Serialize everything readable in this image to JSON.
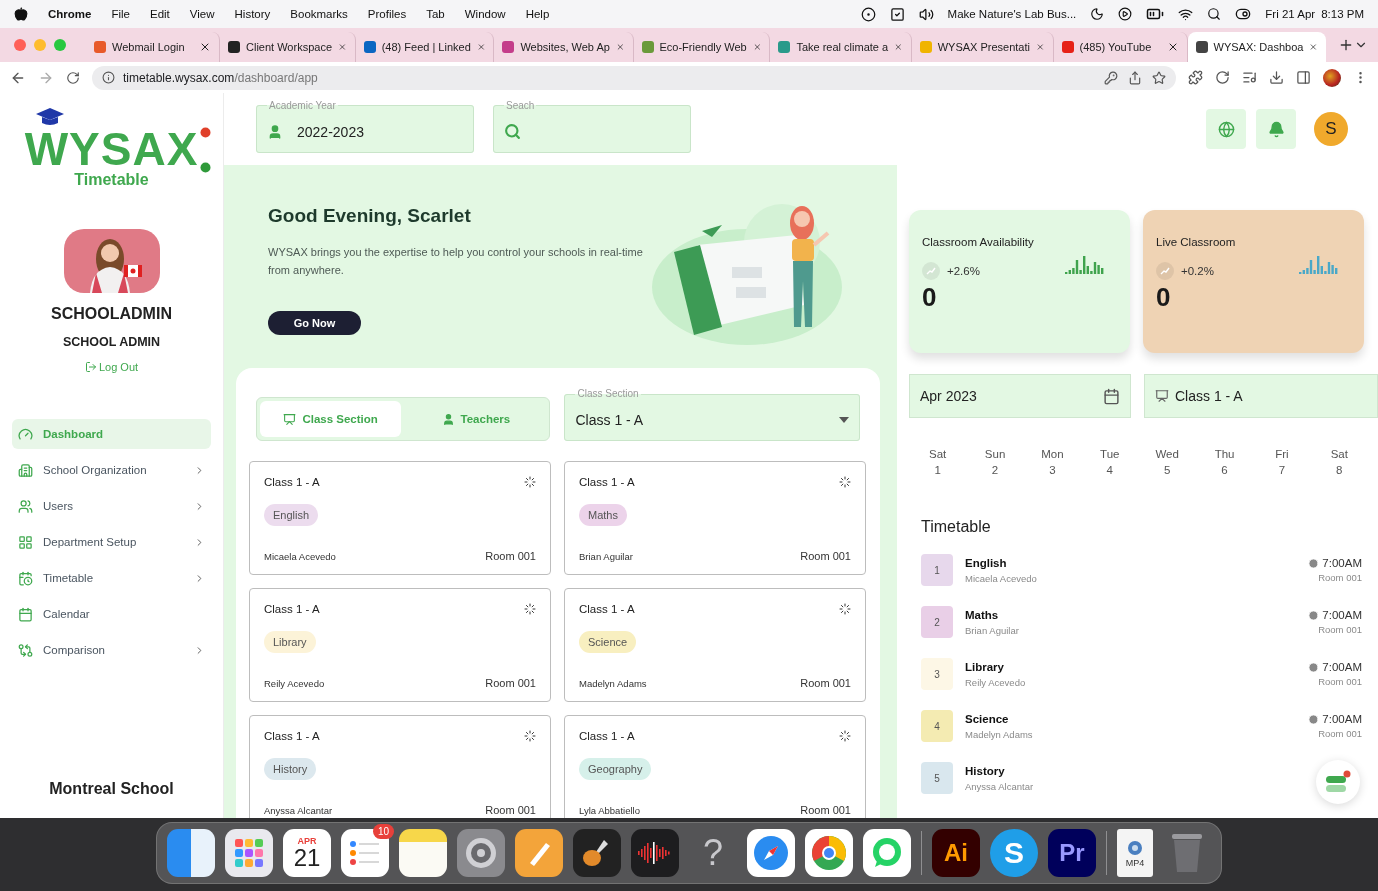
{
  "menubar": {
    "app": "Chrome",
    "menus": [
      "File",
      "Edit",
      "View",
      "History",
      "Bookmarks",
      "Profiles",
      "Tab",
      "Window",
      "Help"
    ],
    "now_playing": "Make Nature's Lab Bus...",
    "date": "Fri 21 Apr",
    "time": "8:13 PM"
  },
  "browser": {
    "tabs": [
      {
        "title": "Webmail Login",
        "selected": false
      },
      {
        "title": "Client Workspace",
        "selected": false
      },
      {
        "title": "(48) Feed | Linked",
        "selected": false
      },
      {
        "title": "Websites, Web Ap",
        "selected": false
      },
      {
        "title": "Eco-Friendly Web",
        "selected": false
      },
      {
        "title": "Take real climate a",
        "selected": false
      },
      {
        "title": "WYSAX Presentati",
        "selected": false
      },
      {
        "title": "(485) YouTube",
        "selected": false
      },
      {
        "title": "WYSAX: Dashboa",
        "selected": true
      }
    ],
    "url_host": "timetable.wysax.com",
    "url_path": "/dashboard/app"
  },
  "sidebar": {
    "logo": "WYSAX",
    "logo_sub": "Timetable",
    "name": "SCHOOLADMIN",
    "role": "SCHOOL ADMIN",
    "logout": "Log Out",
    "nav": [
      {
        "label": "Dashboard",
        "selected": true,
        "expandable": false
      },
      {
        "label": "School Organization",
        "selected": false,
        "expandable": true
      },
      {
        "label": "Users",
        "selected": false,
        "expandable": true
      },
      {
        "label": "Department Setup",
        "selected": false,
        "expandable": true
      },
      {
        "label": "Timetable",
        "selected": false,
        "expandable": true
      },
      {
        "label": "Calendar",
        "selected": false,
        "expandable": false
      },
      {
        "label": "Comparison",
        "selected": false,
        "expandable": true
      }
    ],
    "school": "Montreal School"
  },
  "topbar": {
    "year_field": {
      "label": "Academic Year",
      "value": "2022-2023"
    },
    "search_field": {
      "label": "Seach"
    },
    "avatar": "S"
  },
  "hero": {
    "title": "Good Evening, Scarlet",
    "text": "WYSAX brings you the expertise to help you control your schools in real-time from anywhere.",
    "button": "Go Now"
  },
  "class_panel": {
    "view_tabs": [
      {
        "label": "Class Section",
        "selected": true
      },
      {
        "label": "Teachers",
        "selected": false
      }
    ],
    "section_select": {
      "label": "Class Section",
      "value": "Class 1 - A"
    },
    "cards": [
      {
        "class": "Class 1 - A",
        "subject": "English",
        "color": "#ecdcee",
        "teacher": "Micaela Acevedo",
        "room": "Room 001"
      },
      {
        "class": "Class 1 - A",
        "subject": "Maths",
        "color": "#ecd3ea",
        "teacher": "Brian Aguilar",
        "room": "Room 001"
      },
      {
        "class": "Class 1 - A",
        "subject": "Library",
        "color": "#fcf3d8",
        "teacher": "Reily Acevedo",
        "room": "Room 001"
      },
      {
        "class": "Class 1 - A",
        "subject": "Science",
        "color": "#f8efc0",
        "teacher": "Madelyn Adams",
        "room": "Room 001"
      },
      {
        "class": "Class 1 - A",
        "subject": "History",
        "color": "#dce8ee",
        "teacher": "Anyssa Alcantar",
        "room": "Room 001"
      },
      {
        "class": "Class 1 - A",
        "subject": "Geography",
        "color": "#d6f0ea",
        "teacher": "Lyla Abbatiello",
        "room": "Room 001"
      }
    ]
  },
  "stats": [
    {
      "title": "Classroom Availability",
      "change": "+2.6%",
      "value": "0",
      "color": "#e3f8e3"
    },
    {
      "title": "Live Classroom",
      "change": "+0.2%",
      "value": "0",
      "color": "#efd3b4"
    }
  ],
  "schedule": {
    "month_field": "Apr 2023",
    "class_field": "Class 1 - A",
    "days": [
      {
        "day": "Sat",
        "date": "1"
      },
      {
        "day": "Sun",
        "date": "2"
      },
      {
        "day": "Mon",
        "date": "3"
      },
      {
        "day": "Tue",
        "date": "4"
      },
      {
        "day": "Wed",
        "date": "5"
      },
      {
        "day": "Thu",
        "date": "6"
      },
      {
        "day": "Fri",
        "date": "7"
      },
      {
        "day": "Sat",
        "date": "8"
      }
    ],
    "title": "Timetable",
    "entries": [
      {
        "number": "1",
        "subject": "English",
        "teacher": "Micaela Acevedo",
        "time": "7:00AM",
        "room": "Room 001",
        "color": "#e7d8ec"
      },
      {
        "number": "2",
        "subject": "Maths",
        "teacher": "Brian Aguilar",
        "time": "7:00AM",
        "room": "Room 001",
        "color": "#e9cfe7"
      },
      {
        "number": "3",
        "subject": "Library",
        "teacher": "Reily Acevedo",
        "time": "7:00AM",
        "room": "Room 001",
        "color": "#fdf7e6"
      },
      {
        "number": "4",
        "subject": "Science",
        "teacher": "Madelyn Adams",
        "time": "7:00AM",
        "room": "Room 001",
        "color": "#f4ebb2"
      },
      {
        "number": "5",
        "subject": "History",
        "teacher": "Anyssa Alcantar",
        "color": "#d9e7ee"
      }
    ]
  },
  "dock": [
    {
      "kind": "finder"
    },
    {
      "kind": "launchpad"
    },
    {
      "kind": "calendar",
      "month": "APR",
      "day": "21"
    },
    {
      "kind": "reminders",
      "badge": "10"
    },
    {
      "kind": "notes"
    },
    {
      "kind": "settings"
    },
    {
      "kind": "pages"
    },
    {
      "kind": "garageband"
    },
    {
      "kind": "voicememos"
    },
    {
      "kind": "help",
      "label": "?"
    },
    {
      "kind": "safari"
    },
    {
      "kind": "chrome"
    },
    {
      "kind": "whatsapp"
    },
    {
      "kind": "separator"
    },
    {
      "kind": "illustrator",
      "label": "Ai"
    },
    {
      "kind": "skype",
      "label": "S"
    },
    {
      "kind": "premiere",
      "label": "Pr"
    },
    {
      "kind": "separator"
    },
    {
      "kind": "file",
      "label": "MP4"
    },
    {
      "kind": "trash"
    }
  ]
}
